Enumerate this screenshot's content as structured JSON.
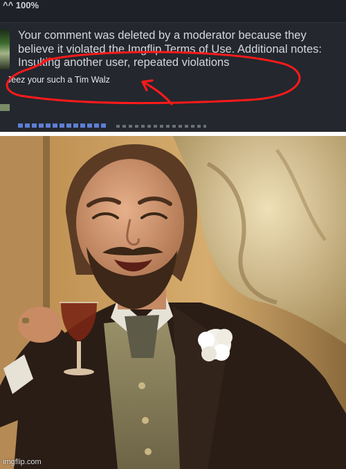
{
  "comment": {
    "vote_text": "^^ 100%",
    "notice_text": "Your comment was deleted by a moderator because they believe it violated the Imgflip Terms of Use. Additional notes: Insulting another user, repeated violations",
    "reply_text": "Jeez your such a Tim Walz",
    "annotation_color": "#ff1a1a"
  },
  "meme": {
    "watermark": "imgflip.com",
    "colors": {
      "wall": "#c8a56a",
      "statue": "#e2d2a6",
      "coat": "#2a1d16",
      "skin": "#d49b76",
      "hair": "#5b3b24",
      "beard": "#3c2718",
      "flower": "#f4f1ea",
      "drink": "#7a2614"
    }
  }
}
